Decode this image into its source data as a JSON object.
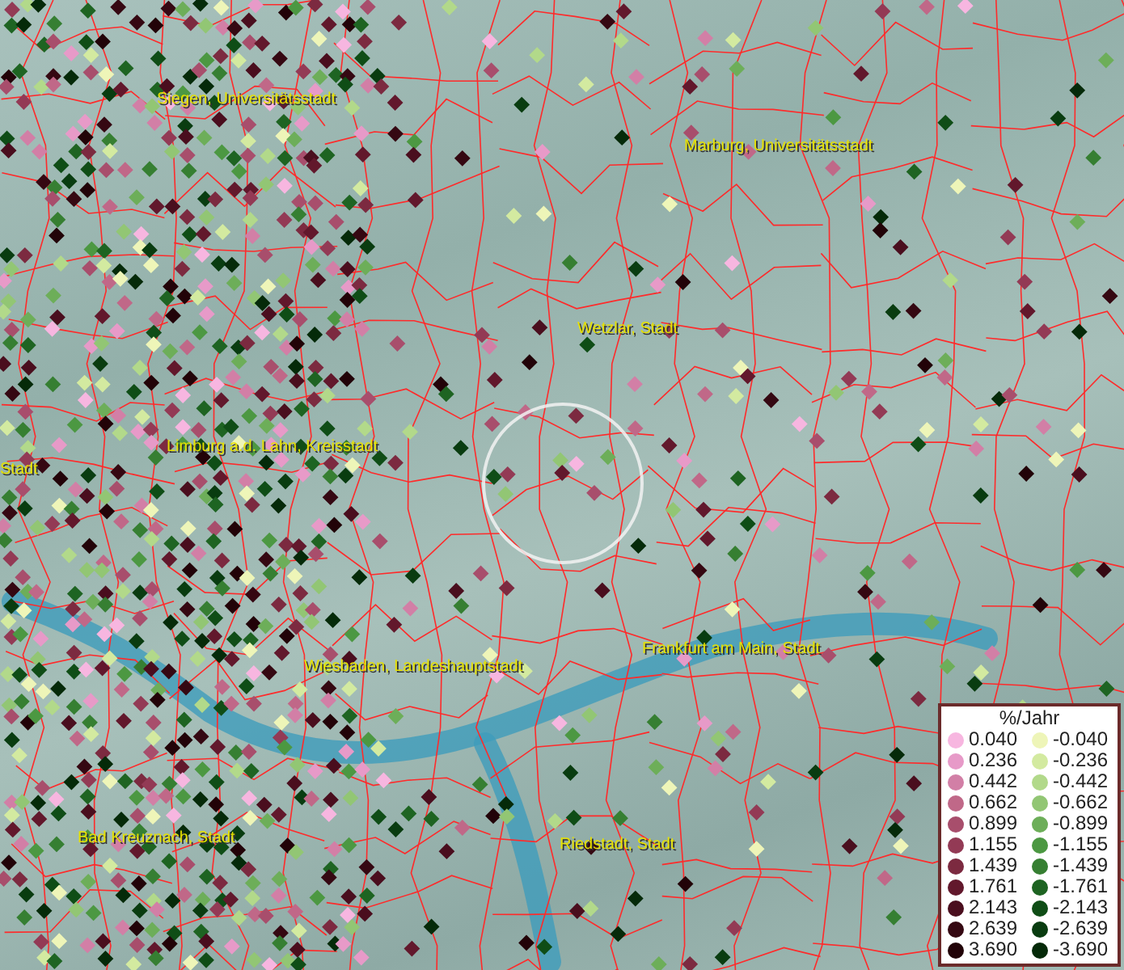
{
  "map": {
    "places": [
      {
        "label": "Siegen, Universitätsstadt"
      },
      {
        "label": "Marburg, Universitätsstadt"
      },
      {
        "label": "Wetzlar, Stadt"
      },
      {
        "label": "Limburg a.d. Lahn, Kreisstadt"
      },
      {
        "label": "Stadt"
      },
      {
        "label": "Frankfurt am Main, Stadt"
      },
      {
        "label": "Wiesbaden, Landeshauptstadt"
      },
      {
        "label": "Bad Kreuznach, Stadt"
      },
      {
        "label": "Riedstadt, Stadt"
      }
    ]
  },
  "legend": {
    "title": "%/Jahr",
    "positive": [
      {
        "label": "0.040",
        "color": "#f7b6e0"
      },
      {
        "label": "0.236",
        "color": "#e79ac8"
      },
      {
        "label": "0.442",
        "color": "#d27fa6"
      },
      {
        "label": "0.662",
        "color": "#c06888"
      },
      {
        "label": "0.899",
        "color": "#a84e6c"
      },
      {
        "label": "1.155",
        "color": "#933a55"
      },
      {
        "label": "1.439",
        "color": "#7c2a40"
      },
      {
        "label": "1.761",
        "color": "#62182c"
      },
      {
        "label": "2.143",
        "color": "#4a0e1e"
      },
      {
        "label": "2.639",
        "color": "#350812"
      },
      {
        "label": "3.690",
        "color": "#220308"
      }
    ],
    "negative": [
      {
        "label": "-0.040",
        "color": "#eef5b8"
      },
      {
        "label": "-0.236",
        "color": "#d3eaa0"
      },
      {
        "label": "-0.442",
        "color": "#b2d98a"
      },
      {
        "label": "-0.662",
        "color": "#92c674"
      },
      {
        "label": "-0.899",
        "color": "#6dae59"
      },
      {
        "label": "-1.155",
        "color": "#4c9842"
      },
      {
        "label": "-1.439",
        "color": "#367f32"
      },
      {
        "label": "-1.761",
        "color": "#1e6422"
      },
      {
        "label": "-2.143",
        "color": "#0f4d16"
      },
      {
        "label": "-2.639",
        "color": "#093c10"
      },
      {
        "label": "-3.690",
        "color": "#052a09"
      }
    ]
  }
}
